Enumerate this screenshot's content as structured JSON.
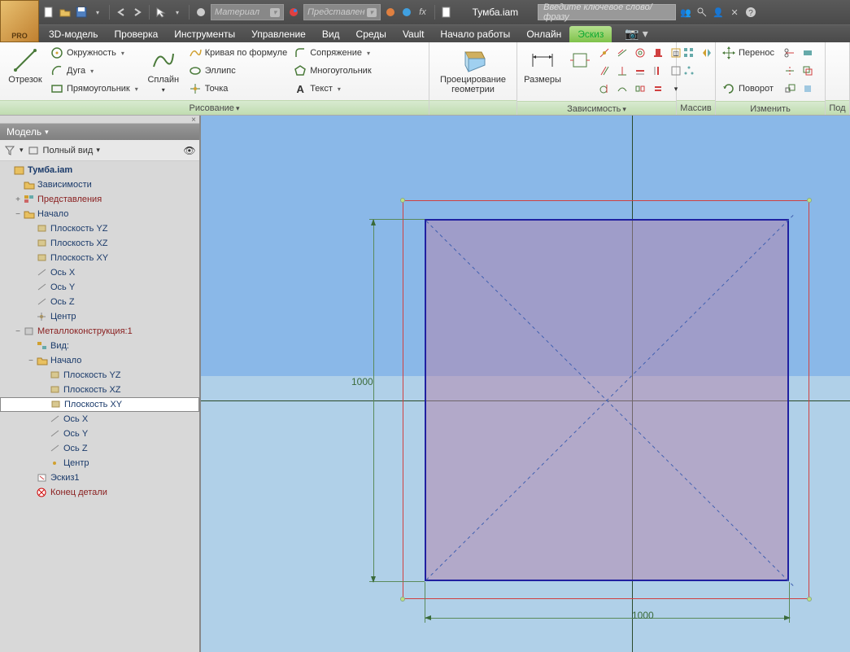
{
  "app": {
    "logo_text": "PRO",
    "doc_title": "Тумба.iam"
  },
  "titlebar": {
    "material_combo": "Материал",
    "view_combo": "Представлен",
    "fx_label": "fx",
    "search_placeholder": "Введите ключевое слово/фразу"
  },
  "menubar": {
    "items": [
      "3D-модель",
      "Проверка",
      "Инструменты",
      "Управление",
      "Вид",
      "Среды",
      "Vault",
      "Начало работы",
      "Онлайн",
      "Эскиз"
    ],
    "active_index": 9
  },
  "ribbon": {
    "draw": {
      "title": "Рисование",
      "line_label": "Отрезок",
      "circle_label": "Окружность",
      "arc_label": "Дуга",
      "rect_label": "Прямоугольник",
      "spline_label": "Сплайн",
      "formula_label": "Кривая по формуле",
      "ellipse_label": "Эллипс",
      "point_label": "Точка",
      "fillet_label": "Сопряжение",
      "polygon_label": "Многоугольник",
      "text_label": "Текст"
    },
    "project": {
      "title": "",
      "label1": "Проецирование",
      "label2": "геометрии"
    },
    "dim": {
      "title": "Зависимость",
      "label": "Размеры"
    },
    "pattern": {
      "title": "Массив"
    },
    "modify": {
      "title": "Изменить",
      "move_label": "Перенос",
      "rotate_label": "Поворот"
    },
    "last": {
      "title": "Под"
    }
  },
  "browser": {
    "header": "Модель",
    "full_view": "Полный вид",
    "tree": {
      "root": "Тумба.iam",
      "deps": "Зависимости",
      "reps": "Представления",
      "origin": "Начало",
      "plane_yz": "Плоскость YZ",
      "plane_xz": "Плоскость XZ",
      "plane_xy": "Плоскость XY",
      "axis_x": "Ось X",
      "axis_y": "Ось Y",
      "axis_z": "Ось Z",
      "center": "Центр",
      "metal": "Металлоконструкция:1",
      "view": "Вид:",
      "origin2": "Начало",
      "sketch": "Эскиз1",
      "eop": "Конец детали"
    }
  },
  "canvas": {
    "dim_v": "1000",
    "dim_h": "1000"
  }
}
